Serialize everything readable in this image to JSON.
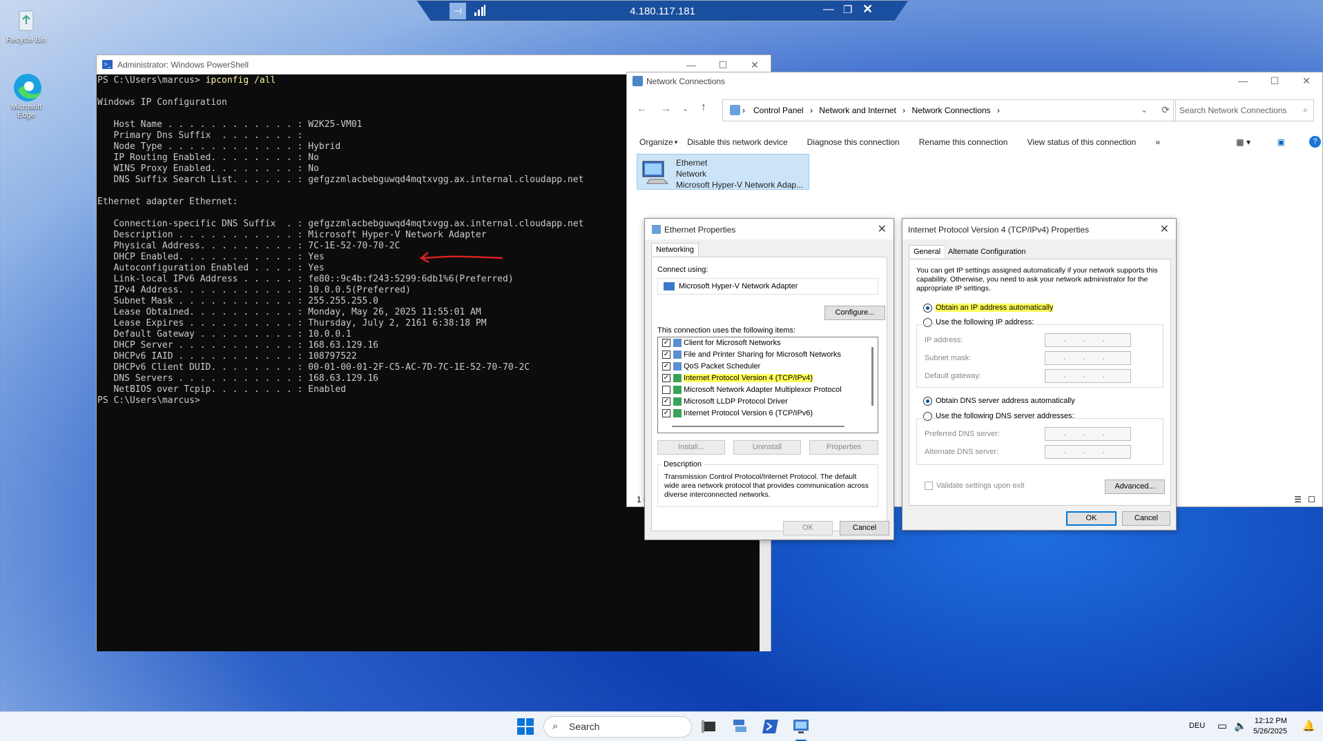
{
  "desktop": {
    "recycle_bin": "Recycle Bin",
    "edge_line1": "Microsoft",
    "edge_line2": "Edge"
  },
  "rdp": {
    "host": "4.180.117.181"
  },
  "powershell": {
    "title": "Administrator: Windows PowerShell",
    "prompt1": "PS C:\\Users\\marcus> ",
    "command": "ipconfig /all",
    "lines": [
      "",
      "Windows IP Configuration",
      "",
      "   Host Name . . . . . . . . . . . . : W2K25-VM01",
      "   Primary Dns Suffix  . . . . . . . :",
      "   Node Type . . . . . . . . . . . . : Hybrid",
      "   IP Routing Enabled. . . . . . . . : No",
      "   WINS Proxy Enabled. . . . . . . . : No",
      "   DNS Suffix Search List. . . . . . : gefgzzmlacbebguwqd4mqtxvgg.ax.internal.cloudapp.net",
      "",
      "Ethernet adapter Ethernet:",
      "",
      "   Connection-specific DNS Suffix  . : gefgzzmlacbebguwqd4mqtxvgg.ax.internal.cloudapp.net",
      "   Description . . . . . . . . . . . : Microsoft Hyper-V Network Adapter",
      "   Physical Address. . . . . . . . . : 7C-1E-52-70-70-2C",
      "   DHCP Enabled. . . . . . . . . . . : Yes",
      "   Autoconfiguration Enabled . . . . : Yes",
      "   Link-local IPv6 Address . . . . . : fe80::9c4b:f243:5299:6db1%6(Preferred)",
      "   IPv4 Address. . . . . . . . . . . : 10.0.0.5(Preferred)",
      "   Subnet Mask . . . . . . . . . . . : 255.255.255.0",
      "   Lease Obtained. . . . . . . . . . : Monday, May 26, 2025 11:55:01 AM",
      "   Lease Expires . . . . . . . . . . : Thursday, July 2, 2161 6:38:18 PM",
      "   Default Gateway . . . . . . . . . : 10.0.0.1",
      "   DHCP Server . . . . . . . . . . . : 168.63.129.16",
      "   DHCPv6 IAID . . . . . . . . . . . : 108797522",
      "   DHCPv6 Client DUID. . . . . . . . : 00-01-00-01-2F-C5-AC-7D-7C-1E-52-70-70-2C",
      "   DNS Servers . . . . . . . . . . . : 168.63.129.16",
      "   NetBIOS over Tcpip. . . . . . . . : Enabled",
      "PS C:\\Users\\marcus>"
    ]
  },
  "network_connections": {
    "title": "Network Connections",
    "breadcrumb": [
      "Control Panel",
      "Network and Internet",
      "Network Connections"
    ],
    "search_placeholder": "Search Network Connections",
    "commands": [
      "Organize",
      "Disable this network device",
      "Diagnose this connection",
      "Rename this connection",
      "View status of this connection"
    ],
    "item": {
      "name": "Ethernet",
      "status": "Network",
      "device": "Microsoft Hyper-V Network Adap..."
    }
  },
  "eth_props": {
    "title": "Ethernet Properties",
    "tab": "Networking",
    "connect_using": "Connect using:",
    "adapter": "Microsoft Hyper-V Network Adapter",
    "configure": "Configure...",
    "items_label": "This connection uses the following items:",
    "items": [
      {
        "label": "Client for Microsoft Networks",
        "checked": true
      },
      {
        "label": "File and Printer Sharing for Microsoft Networks",
        "checked": true
      },
      {
        "label": "QoS Packet Scheduler",
        "checked": true
      },
      {
        "label": "Internet Protocol Version 4 (TCP/IPv4)",
        "checked": true
      },
      {
        "label": "Microsoft Network Adapter Multiplexor Protocol",
        "checked": false
      },
      {
        "label": "Microsoft LLDP Protocol Driver",
        "checked": true
      },
      {
        "label": "Internet Protocol Version 6 (TCP/IPv6)",
        "checked": true
      }
    ],
    "install": "Install...",
    "uninstall": "Uninstall",
    "properties": "Properties",
    "description_label": "Description",
    "description": "Transmission Control Protocol/Internet Protocol. The default wide area network protocol that provides communication across diverse interconnected networks.",
    "ok": "OK",
    "cancel": "Cancel"
  },
  "ipv4": {
    "title": "Internet Protocol Version 4 (TCP/IPv4) Properties",
    "tab_general": "General",
    "tab_alt": "Alternate Configuration",
    "intro": "You can get IP settings assigned automatically if your network supports this capability. Otherwise, you need to ask your network administrator for the appropriate IP settings.",
    "obtain_ip": "Obtain an IP address automatically",
    "use_ip": "Use the following IP address:",
    "ip_address": "IP address:",
    "subnet": "Subnet mask:",
    "gateway": "Default gateway:",
    "obtain_dns": "Obtain DNS server address automatically",
    "use_dns": "Use the following DNS server addresses:",
    "pref_dns": "Preferred DNS server:",
    "alt_dns": "Alternate DNS server:",
    "validate": "Validate settings upon exit",
    "advanced": "Advanced...",
    "ok": "OK",
    "cancel": "Cancel",
    "field_dots": ". . ."
  },
  "taskbar": {
    "search": "Search",
    "lang": "DEU",
    "time": "12:12 PM",
    "date": "5/26/2025"
  },
  "status_left": "1 i"
}
